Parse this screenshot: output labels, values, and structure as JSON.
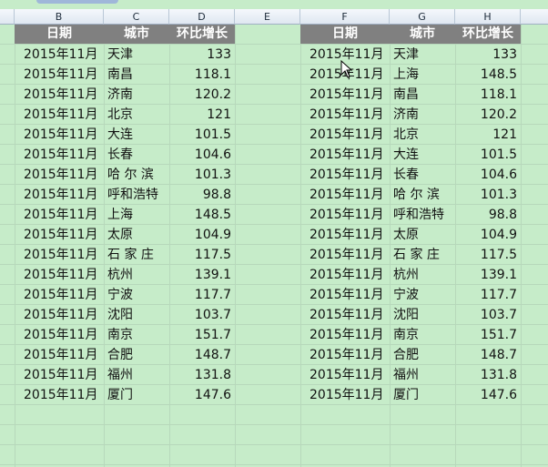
{
  "columns": [
    "B",
    "C",
    "D",
    "E",
    "F",
    "G",
    "H"
  ],
  "table_left": {
    "headers": {
      "date": "日期",
      "city": "城市",
      "growth": "环比增长"
    },
    "rows": [
      {
        "date": "2015年11月",
        "city": "天津",
        "growth": "133"
      },
      {
        "date": "2015年11月",
        "city": "南昌",
        "growth": "118.1"
      },
      {
        "date": "2015年11月",
        "city": "济南",
        "growth": "120.2"
      },
      {
        "date": "2015年11月",
        "city": "北京",
        "growth": "121"
      },
      {
        "date": "2015年11月",
        "city": "大连",
        "growth": "101.5"
      },
      {
        "date": "2015年11月",
        "city": "长春",
        "growth": "104.6"
      },
      {
        "date": "2015年11月",
        "city": "哈 尔 滨",
        "growth": "101.3"
      },
      {
        "date": "2015年11月",
        "city": "呼和浩特",
        "growth": "98.8"
      },
      {
        "date": "2015年11月",
        "city": "上海",
        "growth": "148.5"
      },
      {
        "date": "2015年11月",
        "city": "太原",
        "growth": "104.9"
      },
      {
        "date": "2015年11月",
        "city": "石 家 庄",
        "growth": "117.5"
      },
      {
        "date": "2015年11月",
        "city": "杭州",
        "growth": "139.1"
      },
      {
        "date": "2015年11月",
        "city": "宁波",
        "growth": "117.7"
      },
      {
        "date": "2015年11月",
        "city": "沈阳",
        "growth": "103.7"
      },
      {
        "date": "2015年11月",
        "city": "南京",
        "growth": "151.7"
      },
      {
        "date": "2015年11月",
        "city": "合肥",
        "growth": "148.7"
      },
      {
        "date": "2015年11月",
        "city": "福州",
        "growth": "131.8"
      },
      {
        "date": "2015年11月",
        "city": "厦门",
        "growth": "147.6"
      }
    ]
  },
  "table_right": {
    "headers": {
      "date": "日期",
      "city": "城市",
      "growth": "环比增长"
    },
    "rows": [
      {
        "date": "2015年11月",
        "city": "天津",
        "growth": "133"
      },
      {
        "date": "2015年11月",
        "city": "上海",
        "growth": "148.5"
      },
      {
        "date": "2015年11月",
        "city": "南昌",
        "growth": "118.1"
      },
      {
        "date": "2015年11月",
        "city": "济南",
        "growth": "120.2"
      },
      {
        "date": "2015年11月",
        "city": "北京",
        "growth": "121"
      },
      {
        "date": "2015年11月",
        "city": "大连",
        "growth": "101.5"
      },
      {
        "date": "2015年11月",
        "city": "长春",
        "growth": "104.6"
      },
      {
        "date": "2015年11月",
        "city": "哈 尔 滨",
        "growth": "101.3"
      },
      {
        "date": "2015年11月",
        "city": "呼和浩特",
        "growth": "98.8"
      },
      {
        "date": "2015年11月",
        "city": "太原",
        "growth": "104.9"
      },
      {
        "date": "2015年11月",
        "city": "石 家 庄",
        "growth": "117.5"
      },
      {
        "date": "2015年11月",
        "city": "杭州",
        "growth": "139.1"
      },
      {
        "date": "2015年11月",
        "city": "宁波",
        "growth": "117.7"
      },
      {
        "date": "2015年11月",
        "city": "沈阳",
        "growth": "103.7"
      },
      {
        "date": "2015年11月",
        "city": "南京",
        "growth": "151.7"
      },
      {
        "date": "2015年11月",
        "city": "合肥",
        "growth": "148.7"
      },
      {
        "date": "2015年11月",
        "city": "福州",
        "growth": "131.8"
      },
      {
        "date": "2015年11月",
        "city": "厦门",
        "growth": "147.6"
      }
    ]
  }
}
